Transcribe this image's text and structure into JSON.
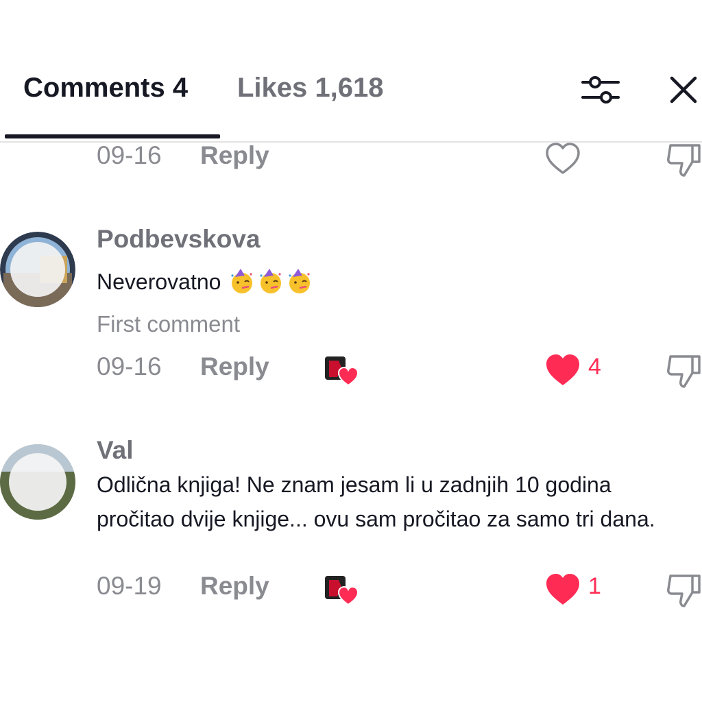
{
  "tabs": {
    "comments_label": "Comments 4",
    "likes_label": "Likes 1,618"
  },
  "header_icons": {
    "filter": "filter-sliders-icon",
    "close": "close-icon"
  },
  "colors": {
    "accent_red": "#fe2c55",
    "text_primary": "#161823",
    "text_secondary": "#8a8b91"
  },
  "comments": [
    {
      "date": "09-16",
      "reply_label": "Reply",
      "liked": false
    },
    {
      "username": "Podbevskova",
      "text": "Neverovatno",
      "emojis": [
        "partying-face-emoji",
        "partying-face-emoji",
        "partying-face-emoji"
      ],
      "badge": "First comment",
      "date": "09-16",
      "reply_label": "Reply",
      "liked_by_creator": true,
      "liked": true,
      "like_count": "4"
    },
    {
      "username": "Val",
      "text": "Odlična knjiga! Ne znam jesam li u zadnjih 10 godina pročitao dvije knjige... ovu sam pročitao za samo tri dana.",
      "date": "09-19",
      "reply_label": "Reply",
      "liked_by_creator": true,
      "liked": true,
      "like_count": "1"
    }
  ]
}
